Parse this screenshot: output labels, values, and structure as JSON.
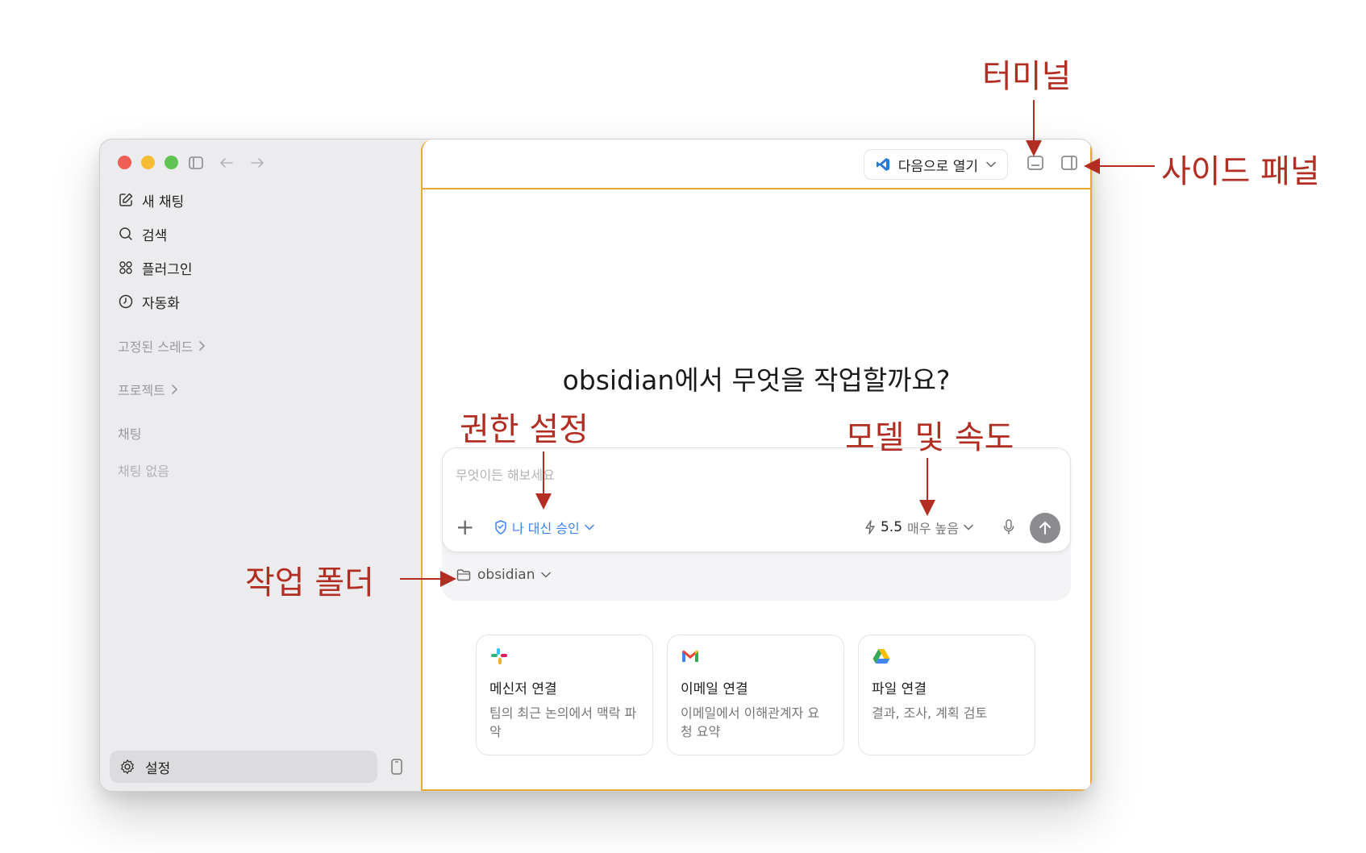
{
  "sidebar": {
    "nav": [
      {
        "label": "새 채팅",
        "icon": "compose-icon"
      },
      {
        "label": "검색",
        "icon": "search-icon"
      },
      {
        "label": "플러그인",
        "icon": "plugins-icon"
      },
      {
        "label": "자동화",
        "icon": "clock-icon"
      }
    ],
    "pinned_label": "고정된 스레드",
    "projects_label": "프로젝트",
    "chats_label": "채팅",
    "no_chats_label": "채팅 없음",
    "settings_label": "설정"
  },
  "topbar": {
    "open_with_label": "다음으로 열기"
  },
  "main": {
    "headline": "obsidian에서 무엇을 작업할까요?",
    "composer": {
      "placeholder": "무엇이든 해보세요",
      "approval_label": "나 대신 승인",
      "model_version": "5.5",
      "speed_label": "매우 높음"
    },
    "folder_label": "obsidian",
    "cards": [
      {
        "title": "메신저 연결",
        "desc": "팀의 최근 논의에서 맥락 파악",
        "icon": "slack-logo-icon"
      },
      {
        "title": "이메일 연결",
        "desc": "이메일에서 이해관계자 요청 요약",
        "icon": "gmail-logo-icon"
      },
      {
        "title": "파일 연결",
        "desc": "결과, 조사, 계획 검토",
        "icon": "drive-logo-icon"
      }
    ]
  },
  "annotations": {
    "terminal": "터미널",
    "side_panel": "사이드 패널",
    "permissions": "권한 설정",
    "model_speed": "모델 및 속도",
    "work_folder": "작업  폴더"
  },
  "colors": {
    "accent_orange": "#e8a83a",
    "annotation_red": "#b22d22",
    "link_blue": "#3b82f6"
  }
}
